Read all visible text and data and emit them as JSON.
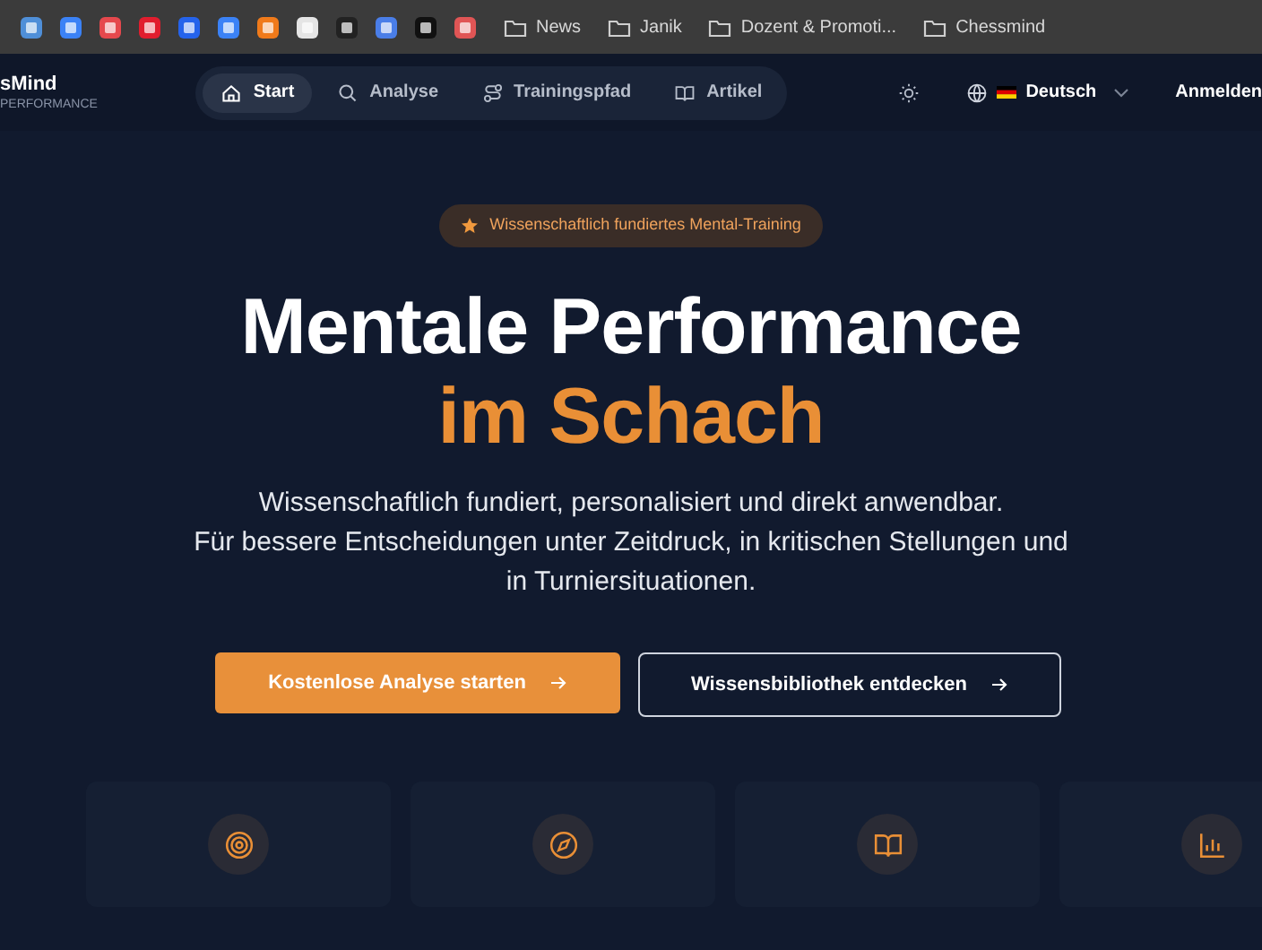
{
  "bookmarks_bar": {
    "folders": [
      "News",
      "Janik",
      "Dozent & Promoti...",
      "Chessmind"
    ]
  },
  "nav": {
    "logo": "sMind",
    "logo_subtitle": "PERFORMANCE",
    "items": [
      {
        "label": "Start",
        "kind": "home",
        "selected": true
      },
      {
        "label": "Analyse",
        "kind": "search",
        "selected": false
      },
      {
        "label": "Trainingspfad",
        "kind": "route",
        "selected": false
      },
      {
        "label": "Artikel",
        "kind": "book",
        "selected": false
      }
    ],
    "language": "Deutsch",
    "login": "Anmelden"
  },
  "hero": {
    "badge": "Wissenschaftlich fundiertes Mental-Training",
    "title": "Mentale Performance",
    "title_accent": "im Schach",
    "lines": [
      "Wissenschaftlich fundiert, personalisiert und direkt anwendbar.",
      "Für bessere Entscheidungen unter Zeitdruck, in kritischen Stellungen und",
      "in Turniersituationen."
    ],
    "primary_button": "Kostenlose Analyse starten",
    "secondary_button": "Wissensbibliothek entdecken"
  },
  "cards": [
    {
      "kind": "target"
    },
    {
      "kind": "compass"
    },
    {
      "kind": "book"
    },
    {
      "kind": "chart"
    }
  ]
}
